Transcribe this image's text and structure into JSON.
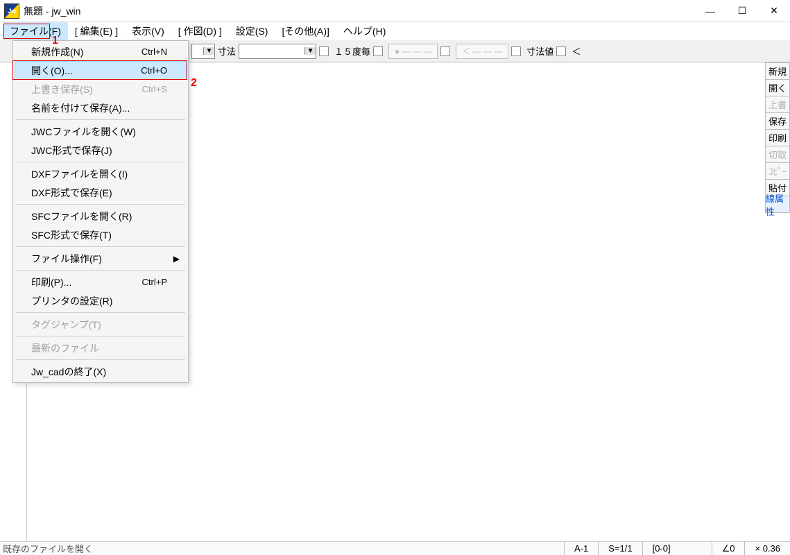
{
  "title": "無題 - jw_win",
  "menubar": [
    "ファイル(F)",
    "[ 編集(E) ]",
    "表示(V)",
    "[ 作図(D) ]",
    "設定(S)",
    "[その他(A)]",
    "ヘルプ(H)"
  ],
  "annotations": {
    "box1_label": "1",
    "box2_label": "2"
  },
  "toolbar": {
    "sunpou_label": "寸法",
    "deg15_label": "１５度毎",
    "sunpouchi_label": "寸法値",
    "lt_label": "＜"
  },
  "dropdown": {
    "items": [
      {
        "label": "新規作成(N)",
        "accel": "Ctrl+N"
      },
      {
        "label": "開く(O)...",
        "accel": "Ctrl+O",
        "highlight": true
      },
      {
        "label": "上書き保存(S)",
        "accel": "Ctrl+S",
        "disabled": true
      },
      {
        "label": "名前を付けて保存(A)..."
      },
      {
        "sep": true
      },
      {
        "label": "JWCファイルを開く(W)"
      },
      {
        "label": "JWC形式で保存(J)"
      },
      {
        "sep": true
      },
      {
        "label": "DXFファイルを開く(I)"
      },
      {
        "label": "DXF形式で保存(E)"
      },
      {
        "sep": true
      },
      {
        "label": "SFCファイルを開く(R)"
      },
      {
        "label": "SFC形式で保存(T)"
      },
      {
        "sep": true
      },
      {
        "label": "ファイル操作(F)",
        "sub": true
      },
      {
        "sep": true
      },
      {
        "label": "印刷(P)...",
        "accel": "Ctrl+P"
      },
      {
        "label": "プリンタの設定(R)"
      },
      {
        "sep": true
      },
      {
        "label": "タグジャンプ(T)",
        "disabled": true
      },
      {
        "sep": true
      },
      {
        "label": "最新のファイル",
        "disabled": true
      },
      {
        "sep": true
      },
      {
        "label": "Jw_cadの終了(X)"
      }
    ]
  },
  "rightbar": [
    {
      "label": "新規"
    },
    {
      "label": "開く"
    },
    {
      "label": "上書",
      "disabled": true
    },
    {
      "label": "保存"
    },
    {
      "label": "印刷"
    },
    {
      "label": "切取",
      "disabled": true
    },
    {
      "label": "ｺﾋﾟｰ",
      "disabled": true
    },
    {
      "label": "貼付"
    },
    {
      "label": "線属性",
      "blue": true
    }
  ],
  "status": {
    "msg": "既存のファイルを開く",
    "a": "A-1",
    "s": "S=1/1",
    "coord": "[0-0]",
    "angle": "∠0",
    "zoom": "× 0.36"
  }
}
